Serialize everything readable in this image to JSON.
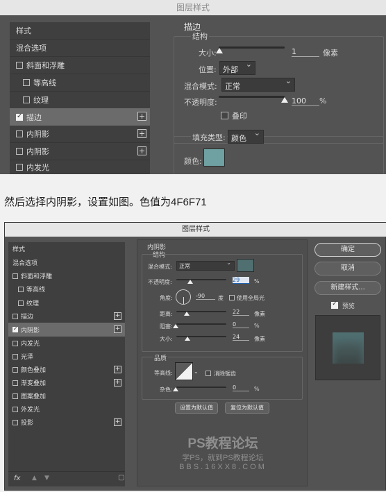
{
  "top_dialog": {
    "title": "图层样式",
    "style_list": [
      "样式",
      "混合选项",
      "斜面和浮雕",
      "等高线",
      "纹理",
      "描边",
      "内阴影",
      "内阴影",
      "内发光"
    ],
    "section_title": "描边",
    "structure_title": "结构",
    "size_label": "大小:",
    "size_value": "1",
    "size_unit": "像素",
    "position_label": "位置:",
    "position_value": "外部",
    "blend_label": "混合模式:",
    "blend_value": "正常",
    "opacity_label": "不透明度:",
    "opacity_value": "100",
    "opacity_unit": "%",
    "overprint_label": "叠印",
    "fill_type_label": "填充类型:",
    "fill_type_value": "颜色",
    "color_label": "颜色:",
    "swatch_color": "#6fa0a2"
  },
  "caption": "然后选择内阴影，设置如图。色值为4F6F71",
  "bottom_dialog": {
    "title": "图层样式",
    "style_list": [
      "样式",
      "混合选项",
      "斜面和浮雕",
      "等高线",
      "纹理",
      "描边",
      "内阴影",
      "内发光",
      "光泽",
      "颜色叠加",
      "渐变叠加",
      "图案叠加",
      "外发光",
      "投影"
    ],
    "section_title": "内阴影",
    "structure_title": "结构",
    "blend_label": "混合模式:",
    "blend_value": "正常",
    "swatch_color": "#4f6f71",
    "opacity_label": "不透明度:",
    "opacity_value": "29",
    "opacity_unit": "%",
    "angle_label": "角度:",
    "angle_value": "-90",
    "angle_unit": "度",
    "global_light_label": "使用全局光",
    "distance_label": "距离:",
    "distance_value": "22",
    "distance_unit": "像素",
    "choke_label": "阻塞:",
    "choke_value": "0",
    "choke_unit": "%",
    "size_label": "大小:",
    "size_value": "24",
    "size_unit": "像素",
    "quality_title": "品质",
    "contour_label": "等高线:",
    "antialias_label": "消除锯齿",
    "noise_label": "杂色:",
    "noise_value": "0",
    "noise_unit": "%",
    "set_default_label": "设置为默认值",
    "reset_default_label": "复位为默认值",
    "ok_label": "确定",
    "cancel_label": "取消",
    "new_style_label": "新建样式...",
    "preview_label": "预览",
    "fx_label": "fx",
    "watermark_title": "PS教程论坛",
    "watermark_sub": "学PS，就到PS教程论坛",
    "watermark_url": "BBS.16XX8.COM"
  },
  "sliders": {
    "top_size": 0.01,
    "top_opacity": 1.0,
    "bottom_opacity": 0.29,
    "bottom_distance": 0.22,
    "bottom_choke": 0.0,
    "bottom_size": 0.24,
    "bottom_noise": 0.0
  }
}
